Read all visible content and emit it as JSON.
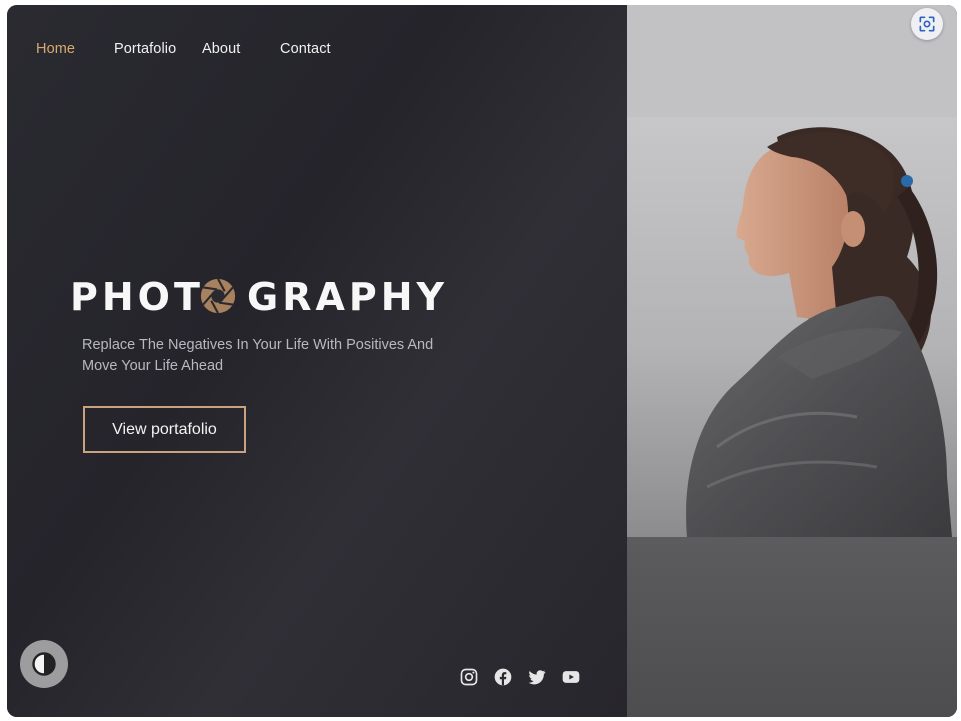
{
  "nav": {
    "items": [
      {
        "label": "Home",
        "active": true
      },
      {
        "label": "Portafolio",
        "active": false
      },
      {
        "label": "About",
        "active": false
      },
      {
        "label": "Contact",
        "active": false
      }
    ]
  },
  "hero": {
    "title_left": "PHOT",
    "title_right": "GRAPHY",
    "title_icon": "camera-aperture-icon",
    "tagline": "Replace The Negatives In Your Life With Positives And Move Your Life Ahead",
    "cta_label": "View portafolio"
  },
  "social": [
    "instagram-icon",
    "facebook-icon",
    "twitter-icon",
    "youtube-icon"
  ],
  "photo": {
    "subject": "portrait-photo"
  },
  "controls": {
    "lens_icon": "visual-search-icon",
    "theme_icon": "contrast-toggle-icon"
  },
  "colors": {
    "accent": "#d7ab6f",
    "button_border": "#c9a27e",
    "background": "#27262c"
  }
}
